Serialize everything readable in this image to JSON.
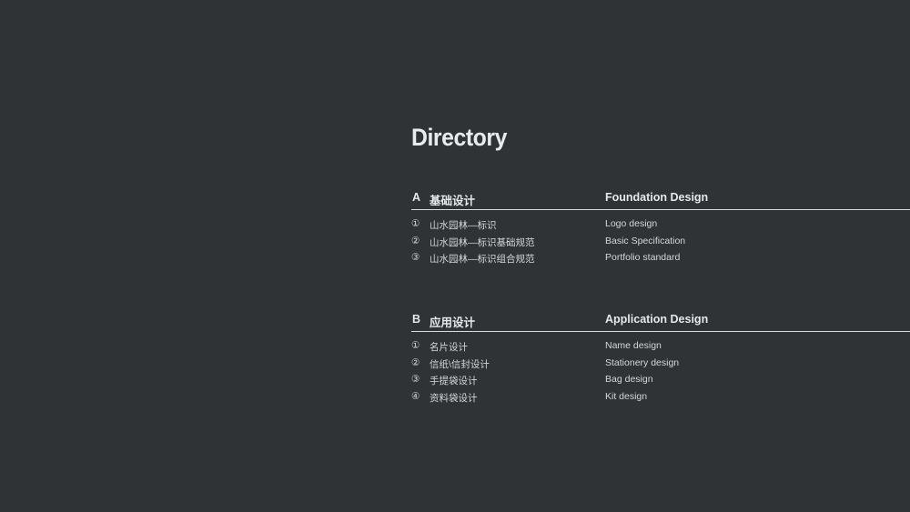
{
  "title": "Directory",
  "sections": [
    {
      "letter": "A",
      "cn": "基础设计",
      "en": "Foundation Design",
      "items": [
        {
          "num": "①",
          "cn": "山水园林—标识",
          "en": "Logo design"
        },
        {
          "num": "②",
          "cn": "山水园林—标识基础规范",
          "en": "Basic Specification"
        },
        {
          "num": "③",
          "cn": "山水园林—标识组合规范",
          "en": "Portfolio standard"
        }
      ]
    },
    {
      "letter": "B",
      "cn": "应用设计",
      "en": "Application Design",
      "items": [
        {
          "num": "①",
          "cn": "名片设计",
          "en": "Name design"
        },
        {
          "num": "②",
          "cn": "信纸\\信封设计",
          "en": "Stationery design"
        },
        {
          "num": "③",
          "cn": "手提袋设计",
          "en": "Bag design"
        },
        {
          "num": "④",
          "cn": "资料袋设计",
          "en": "Kit design"
        }
      ]
    }
  ]
}
